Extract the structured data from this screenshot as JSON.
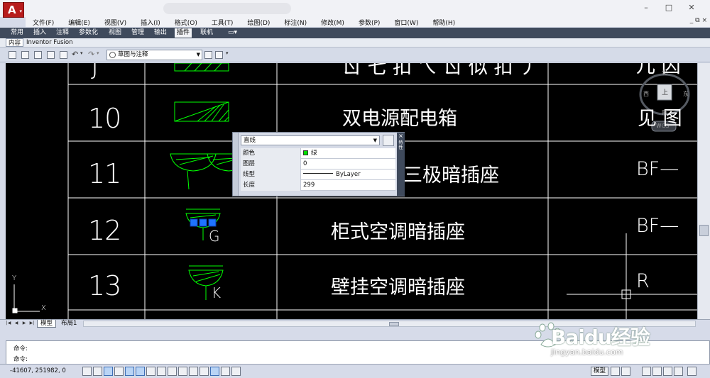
{
  "window": {
    "app_letter": "A",
    "controls": [
      "–",
      "□",
      "✕"
    ],
    "mdi_controls": "_ ⧉ ×"
  },
  "menu": [
    "文件(F)",
    "编辑(E)",
    "视图(V)",
    "插入(I)",
    "格式(O)",
    "工具(T)",
    "绘图(D)",
    "标注(N)",
    "修改(M)",
    "参数(P)",
    "窗口(W)",
    "帮助(H)"
  ],
  "ribbon_tabs": [
    {
      "label": "常用"
    },
    {
      "label": "插入"
    },
    {
      "label": "注释"
    },
    {
      "label": "参数化"
    },
    {
      "label": "视图"
    },
    {
      "label": "管理"
    },
    {
      "label": "输出"
    },
    {
      "label": "插件",
      "active": true
    },
    {
      "label": "联机"
    },
    {
      "label": "▭▾"
    }
  ],
  "panel_tabs": [
    "内容",
    "Inventor Fusion"
  ],
  "toolbar": {
    "workspace": "草图与注释"
  },
  "drawing": {
    "rows": [
      {
        "num": "J",
        "name": "ㄖ 七 扣 ㄟ ㄖ 似 扣 丿",
        "ref": "儿 囚"
      },
      {
        "num": "10",
        "name": "双电源配电箱",
        "ref": "见 图"
      },
      {
        "num": "11",
        "name": "三极暗插座",
        "ref": "BF—"
      },
      {
        "num": "12",
        "name": "柜式空调暗插座",
        "ref": "BF—",
        "symbol_label": "G"
      },
      {
        "num": "13",
        "name": "壁挂空调暗插座",
        "ref": "R",
        "symbol_label": "K"
      }
    ],
    "viewcube": {
      "north": "北",
      "west": "西",
      "east": "东",
      "south": "南",
      "face": "上",
      "wcs": "WCS"
    },
    "ucs": {
      "x": "X",
      "y": "Y"
    },
    "line_color": "#00ff00"
  },
  "quick_properties": {
    "object_type": "直线",
    "side_label": "特性",
    "rows": [
      {
        "key": "颜色",
        "value": "绿",
        "swatch": "#00e000"
      },
      {
        "key": "图层",
        "value": "0"
      },
      {
        "key": "线型",
        "value": "ByLayer"
      },
      {
        "key": "长度",
        "value": "299"
      }
    ]
  },
  "layout_tabs": [
    {
      "label": "模型",
      "active": true
    },
    {
      "label": "布局1"
    }
  ],
  "command": {
    "line1": "命令:",
    "line2": "命令:"
  },
  "status": {
    "coords": "-41607, 251982, 0",
    "model": "模型"
  },
  "watermark": {
    "brand": "Baidu经验",
    "url": "jingyan.baidu.com"
  }
}
